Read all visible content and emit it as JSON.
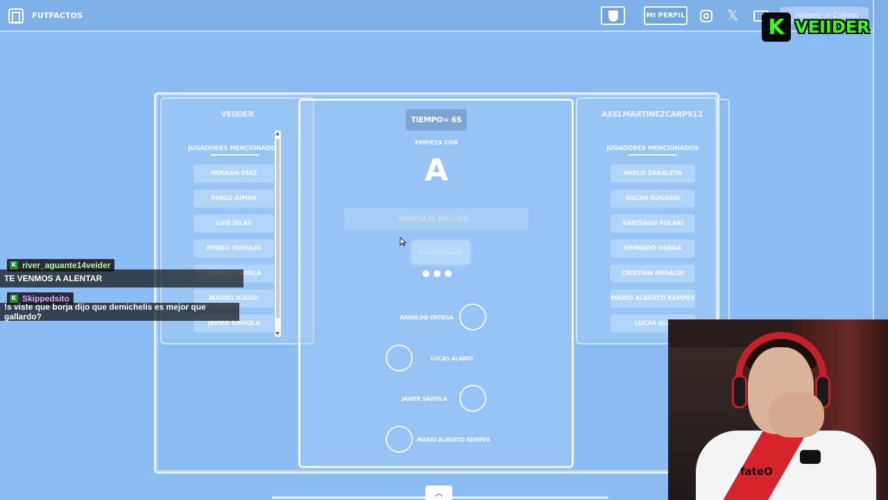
{
  "header": {
    "brand": "FUTFACTOS",
    "profile_label": "MI PERFIL",
    "coffee_label": "Invitame un Cafecito"
  },
  "overlay": {
    "logo_letter": "K",
    "logo_word": "VEIIDER"
  },
  "game": {
    "left_player": {
      "name": "VEIIDER",
      "section_title": "JUGADORES MENCIONADOS",
      "players": [
        "HERNAN DÍAZ",
        "PABLO AIMAR",
        "LUIS ISLAS",
        "PEDRO TROGLIO",
        "ROBERTO AYALA",
        "MAURO ICARDI",
        "JAVIER SAVIOLA"
      ]
    },
    "right_player": {
      "name": "AXELMARTINEZCARP912",
      "section_title": "JUGADORES MENCIONADOS",
      "players": [
        "PABLO ZABALETA",
        "OSCAR RUGGERI",
        "SANTIAGO SOLARI",
        "ERMINDO ONEGA",
        "CRISTIAN ANSALDI",
        "MARIO ALBERTO KEMPES",
        "LUCAS ALA"
      ]
    },
    "center": {
      "timer": "TIEMPO= 6S",
      "starts_with_label": "EMPIEZA CON",
      "letter": "A",
      "surname_placeholder": "INGRESA EL APELLIDO...",
      "break_chain_label": "ROMPER CADENA",
      "chain": [
        "ARNALDO ORTEGA",
        "LUCAS ALARIO",
        "JAVIER SAVIOLA",
        "MARIO ALBERTO KEMPES"
      ]
    }
  },
  "chat": {
    "messages": [
      {
        "user": "river_aguante14veider",
        "user_color": "#b8f5a0",
        "text": "TE VENMOS A ALENTAR"
      },
      {
        "user": "Skippedsito",
        "user_color": "#e0a8ff",
        "text": "!s viste que borja dijo que demichelis es mejor que gallardo?"
      }
    ]
  },
  "webcam": {
    "shirt_text": "fateO"
  },
  "colors": {
    "page_bg": "#8bbcf3",
    "accent_green": "#39ff14",
    "shirt_red": "#d8232a"
  }
}
